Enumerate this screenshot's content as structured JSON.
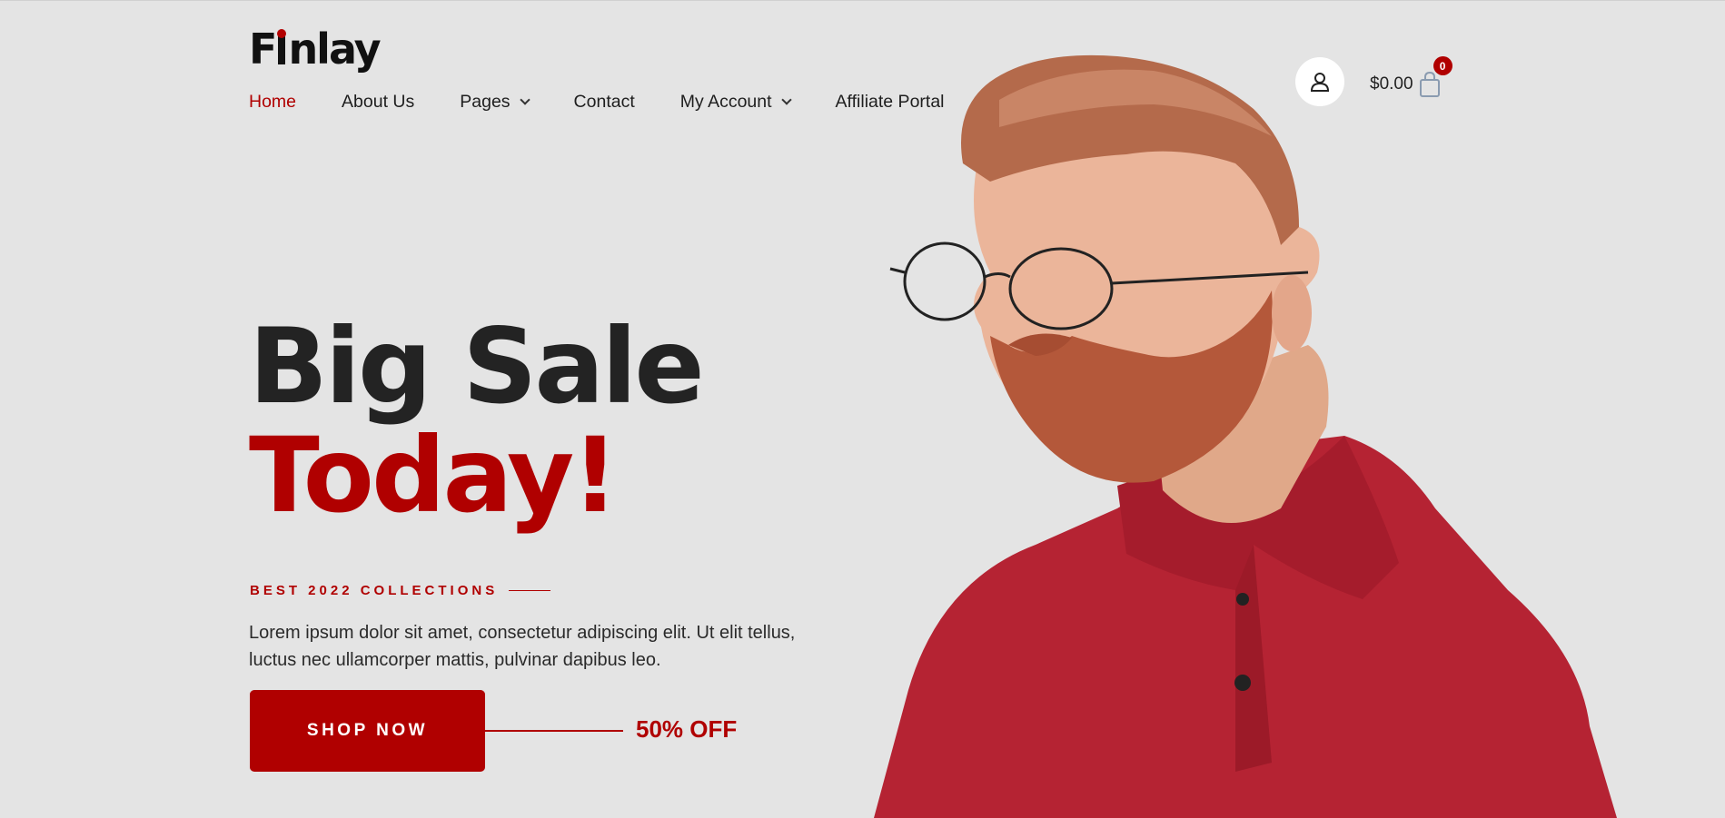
{
  "brand": {
    "logo_text_pre": "F",
    "logo_text_post": "nlay"
  },
  "nav": {
    "items": [
      {
        "label": "Home",
        "active": true,
        "has_dropdown": false
      },
      {
        "label": "About Us",
        "active": false,
        "has_dropdown": false
      },
      {
        "label": "Pages",
        "active": false,
        "has_dropdown": true
      },
      {
        "label": "Contact",
        "active": false,
        "has_dropdown": false
      },
      {
        "label": "My Account",
        "active": false,
        "has_dropdown": true
      },
      {
        "label": "Affiliate Portal",
        "active": false,
        "has_dropdown": false
      }
    ]
  },
  "header": {
    "account_icon": "user-icon",
    "cart_total": "$0.00",
    "cart_icon": "shopping-bag-icon",
    "cart_count": "0"
  },
  "hero": {
    "headline_line1": "Big Sale",
    "headline_line2": "Today!",
    "eyebrow": "BEST 2022 COLLECTIONS",
    "body": "Lorem ipsum dolor sit amet, consectetur adipiscing elit. Ut elit tellus, luctus nec ullamcorper mattis, pulvinar dapibus leo.",
    "cta_label": "SHOP NOW",
    "discount_label": "50% OFF"
  },
  "colors": {
    "accent": "#b00000",
    "background": "#e4e4e4",
    "text": "#232323"
  }
}
